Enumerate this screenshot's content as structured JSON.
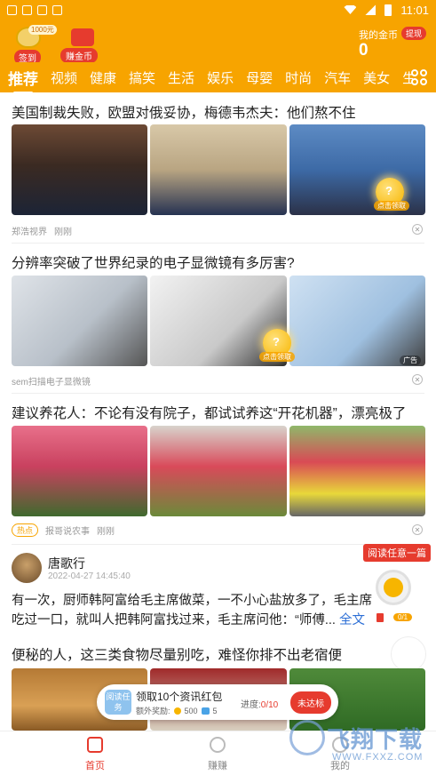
{
  "status_bar": {
    "time": "11:01"
  },
  "header": {
    "signin_badge": "1000元",
    "signin_label": "签到",
    "earn_label": "赚金币",
    "my_coins_label": "我的金币",
    "withdraw_label": "提现",
    "coin_value": "0"
  },
  "tabs": [
    "推荐",
    "视频",
    "健康",
    "搞笑",
    "生活",
    "娱乐",
    "母婴",
    "时尚",
    "汽车",
    "美女",
    "生"
  ],
  "colors": {
    "brand_orange": "#f7a400",
    "accent_red": "#e63b2e",
    "link_blue": "#2d6fd6"
  },
  "articles": [
    {
      "title": "美国制裁失败，欧盟对俄妥协，梅德韦杰夫：他们熬不住",
      "source": "郑浩视界",
      "time": "刚刚",
      "coin_label": "点击领取"
    },
    {
      "title": "分辨率突破了世界纪录的电子显微镜有多厉害?",
      "source": "sem扫描电子显微镜",
      "coin_label": "点击领取",
      "ad_tag": "广告"
    },
    {
      "title": "建议养花人：不论有没有院子，都试试养这“开花机器”，漂亮极了",
      "tag": "热点",
      "source": "报哥说农事",
      "time": "刚刚"
    },
    {
      "title": "便秘的人，这三类食物尽量别吃，难怪你排不出老宿便"
    }
  ],
  "post": {
    "author": "唐歌行",
    "time": "2022-04-27 14:45:40",
    "text": "有一次，厨师韩阿富给毛主席做菜，一不小心盐放多了，毛主席吃过一口，就叫人把韩阿富找过来，毛主席问他：“师傅...",
    "more": "全文"
  },
  "reading_task": {
    "label": "阅读任意一篇",
    "progress": "0/1"
  },
  "task_bar": {
    "icon_text": "阅读任务",
    "title": "领取10个资讯红包",
    "bonus_label": "额外奖励:",
    "coin_reward": "500",
    "box_reward": "5",
    "progress_label": "进度:",
    "progress_value": "0/10",
    "button": "未达标"
  },
  "bottom_nav": [
    {
      "label": "首页",
      "icon": "home-icon"
    },
    {
      "label": "赚赚",
      "icon": "coin-icon"
    },
    {
      "label": "我的",
      "icon": "profile-icon"
    }
  ],
  "watermark": {
    "text": "飞翔下载",
    "url": "WWW.FXXZ.COM"
  }
}
